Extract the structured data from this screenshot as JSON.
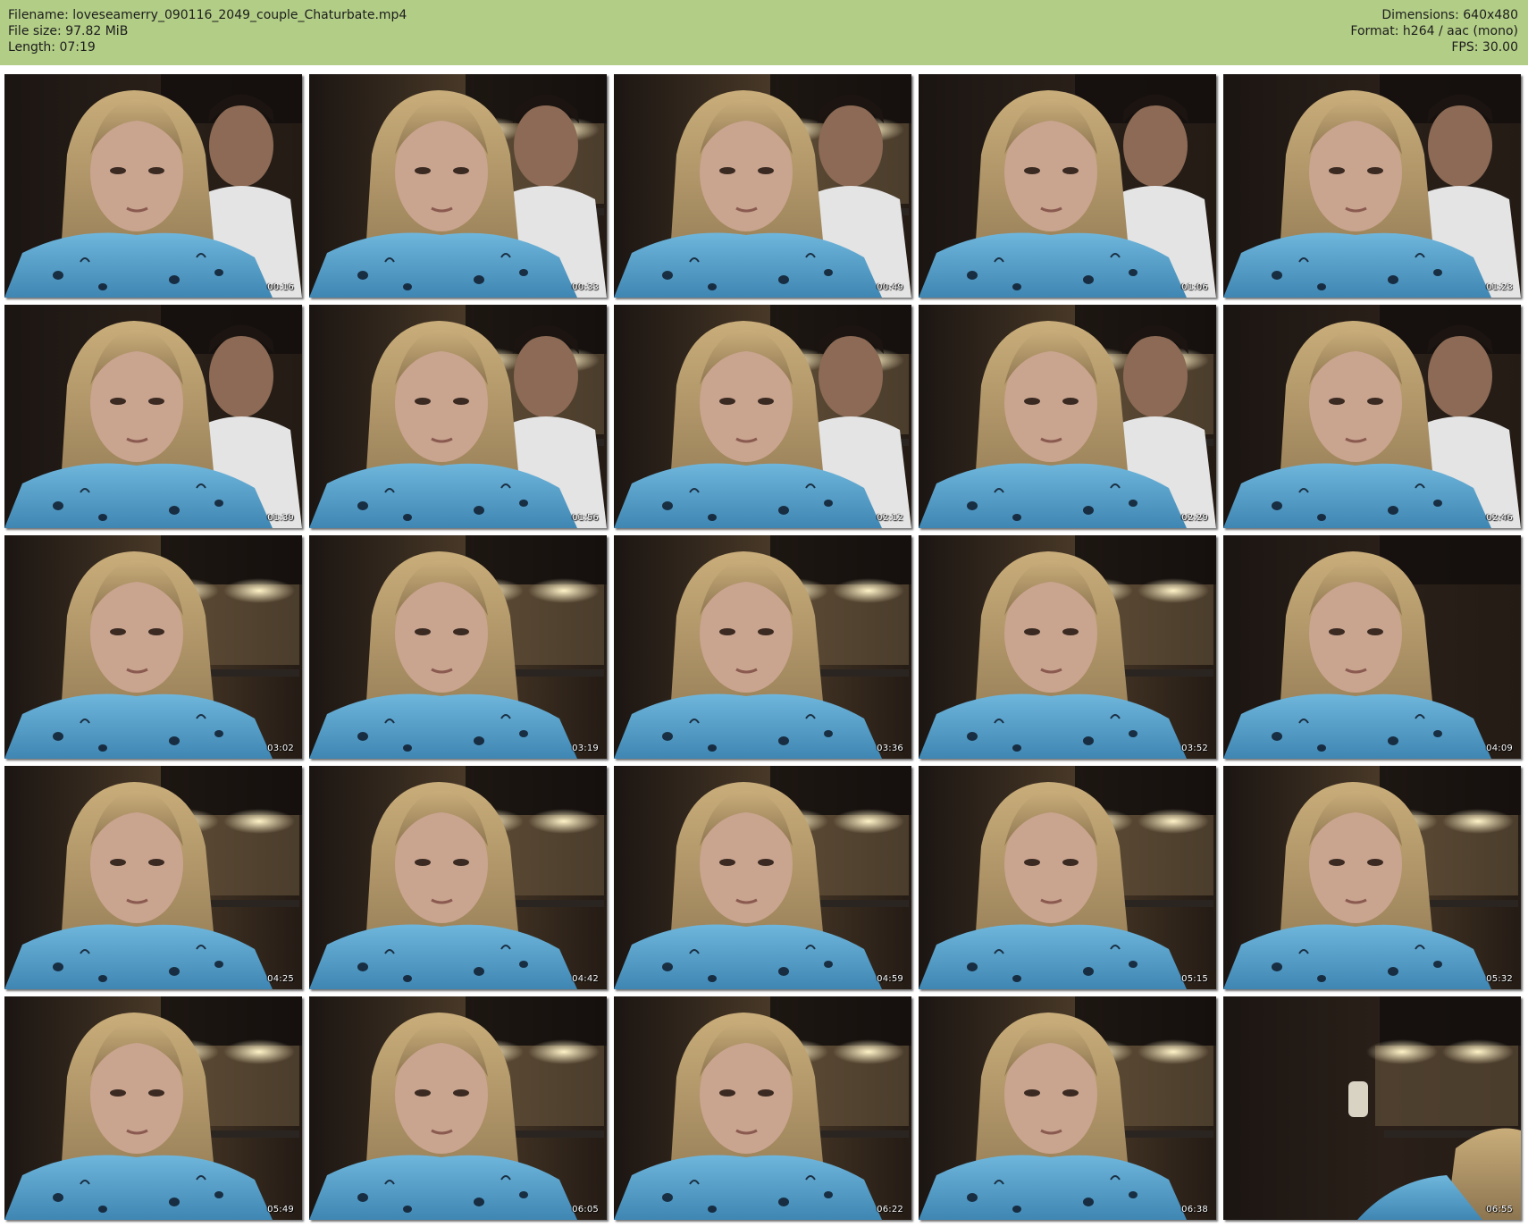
{
  "header": {
    "left": [
      "Filename: loveseamerry_090116_2049_couple_Chaturbate.mp4",
      "File size: 97.82 MiB",
      "Length: 07:19"
    ],
    "right": [
      "Dimensions: 640x480",
      "Format: h264 / aac (mono)",
      "FPS: 30.00"
    ]
  },
  "colors": {
    "header_background": "#b2cd86",
    "page_background": "#ffffff",
    "timestamp_text": "#ffffff"
  },
  "thumbnails": [
    {
      "time": "00:16",
      "man": true,
      "variant": "dark"
    },
    {
      "time": "00:33",
      "man": true,
      "variant": "kitchen"
    },
    {
      "time": "00:49",
      "man": true,
      "variant": "kitchen"
    },
    {
      "time": "01:06",
      "man": true,
      "variant": "dark"
    },
    {
      "time": "01:23",
      "man": true,
      "variant": "dark"
    },
    {
      "time": "01:39",
      "man": true,
      "variant": "dark"
    },
    {
      "time": "01:56",
      "man": true,
      "variant": "kitchen"
    },
    {
      "time": "02:12",
      "man": true,
      "variant": "kitchen"
    },
    {
      "time": "02:29",
      "man": true,
      "variant": "kitchen"
    },
    {
      "time": "02:46",
      "man": true,
      "variant": "dark"
    },
    {
      "time": "03:02",
      "man": false,
      "variant": "kitchen"
    },
    {
      "time": "03:19",
      "man": false,
      "variant": "kitchen"
    },
    {
      "time": "03:36",
      "man": false,
      "variant": "kitchen"
    },
    {
      "time": "03:52",
      "man": false,
      "variant": "kitchen"
    },
    {
      "time": "04:09",
      "man": false,
      "variant": "dark"
    },
    {
      "time": "04:25",
      "man": false,
      "variant": "kitchen"
    },
    {
      "time": "04:42",
      "man": false,
      "variant": "kitchen"
    },
    {
      "time": "04:59",
      "man": false,
      "variant": "kitchen"
    },
    {
      "time": "05:15",
      "man": false,
      "variant": "kitchen"
    },
    {
      "time": "05:32",
      "man": false,
      "variant": "kitchen"
    },
    {
      "time": "05:49",
      "man": false,
      "variant": "kitchen"
    },
    {
      "time": "06:05",
      "man": false,
      "variant": "kitchen"
    },
    {
      "time": "06:22",
      "man": false,
      "variant": "kitchen"
    },
    {
      "time": "06:38",
      "man": false,
      "variant": "kitchen"
    },
    {
      "time": "06:55",
      "man": false,
      "variant": "empty"
    }
  ]
}
